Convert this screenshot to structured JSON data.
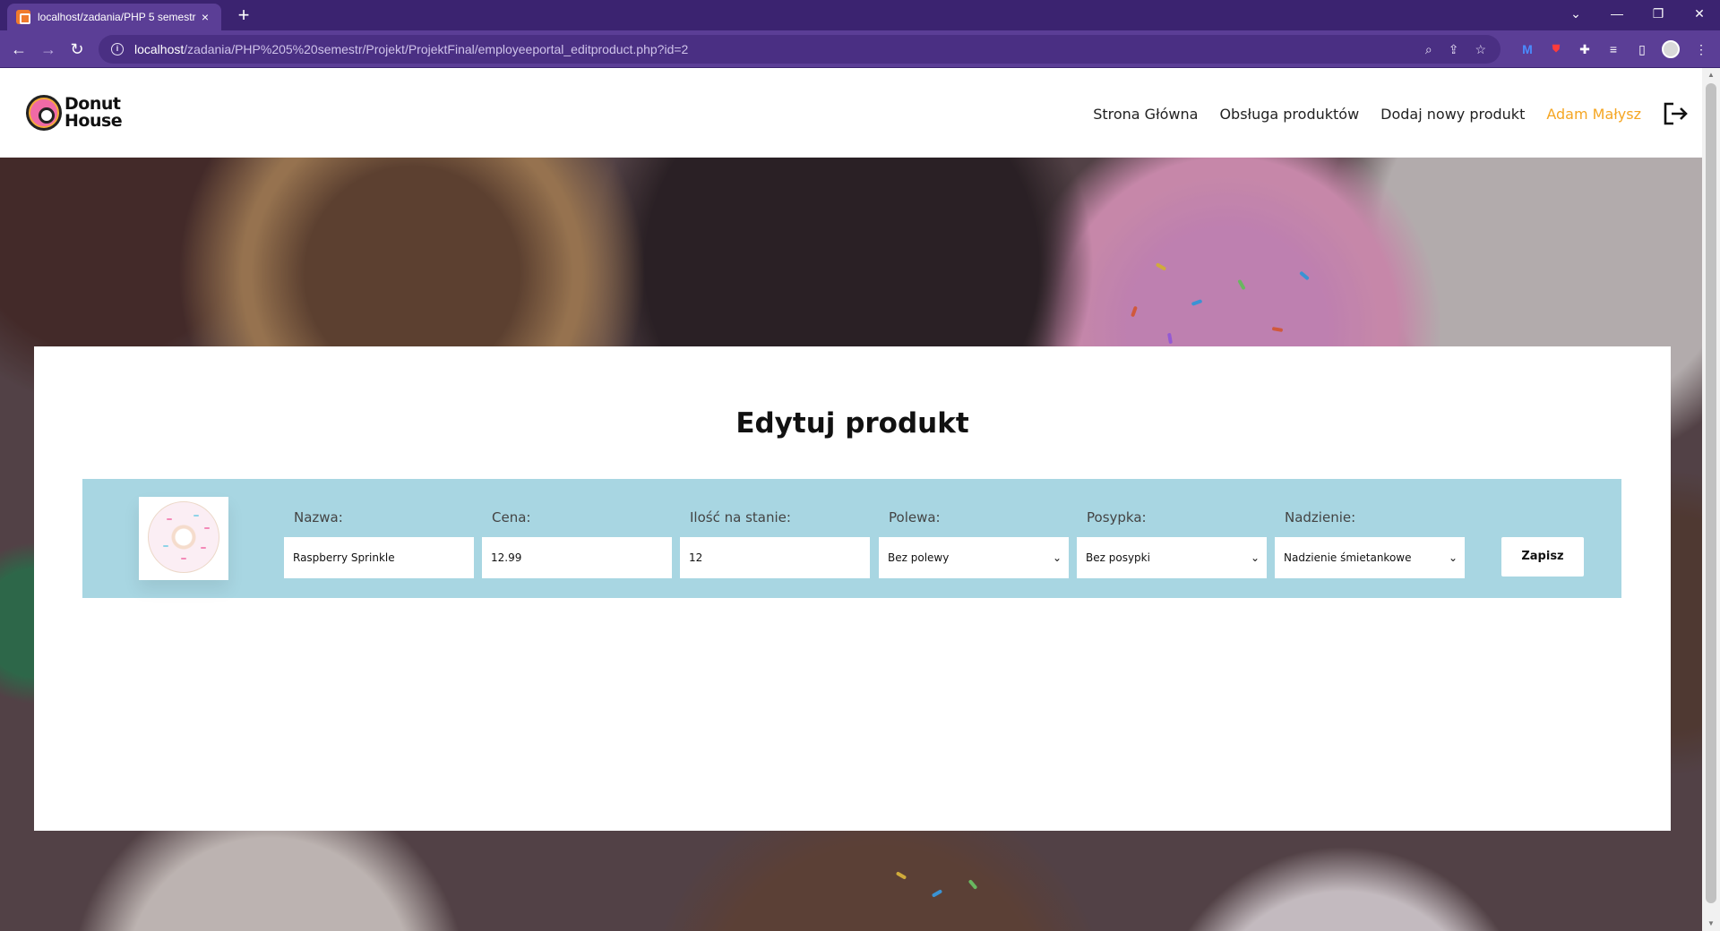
{
  "browser": {
    "tab_title": "localhost/zadania/PHP 5 semestr",
    "url_host": "localhost",
    "url_path": "/zadania/PHP%205%20semestr/Projekt/ProjektFinal/employeeportal_editproduct.php?id=2",
    "new_tab": "+",
    "tab_close": "×"
  },
  "site": {
    "logo_line1": "Donut",
    "logo_line2": "House",
    "nav": {
      "home": "Strona Główna",
      "products": "Obsługa produktów",
      "add_product": "Dodaj nowy produkt",
      "user": "Adam Małysz"
    },
    "colors": {
      "accent": "#f5a623",
      "row_bg": "#a8d6e2",
      "browser": "#5b3e96"
    }
  },
  "form": {
    "title": "Edytuj produkt",
    "fields": {
      "name": {
        "label": "Nazwa:",
        "value": "Raspberry Sprinkle"
      },
      "price": {
        "label": "Cena:",
        "value": "12.99"
      },
      "stock": {
        "label": "Ilość na stanie:",
        "value": "12"
      },
      "glaze": {
        "label": "Polewa:",
        "value": "Bez polewy"
      },
      "sprinkle": {
        "label": "Posypka:",
        "value": "Bez posypki"
      },
      "filling": {
        "label": "Nadzienie:",
        "value": "Nadzienie śmietankowe"
      }
    },
    "save_label": "Zapisz"
  }
}
